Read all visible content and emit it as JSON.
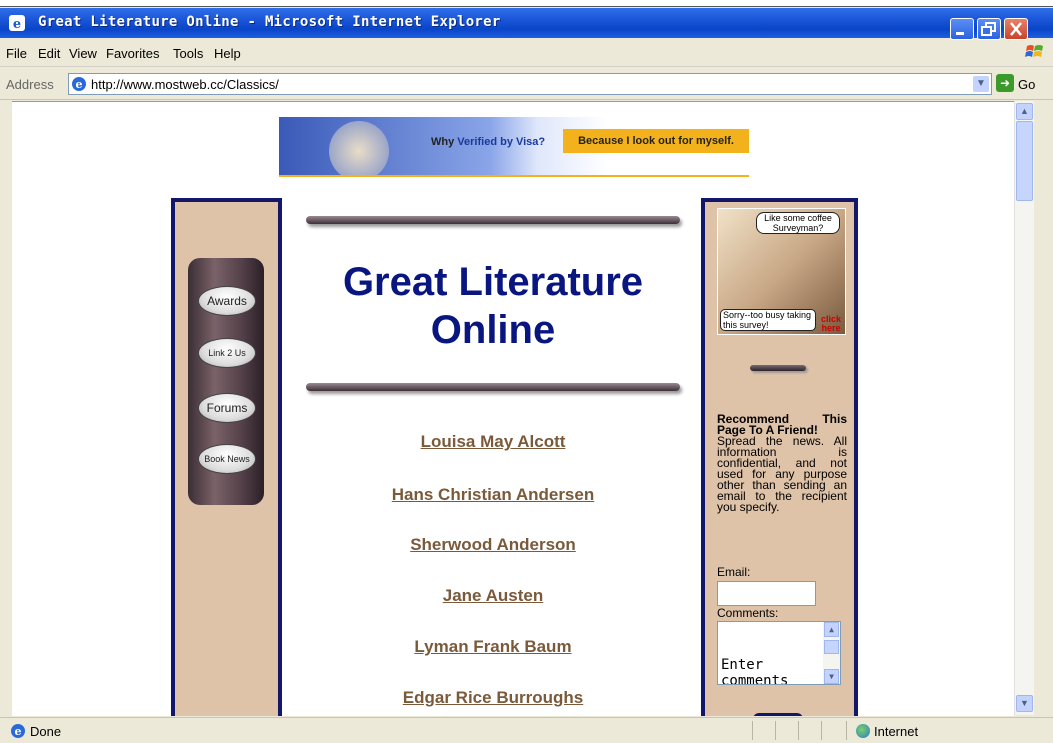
{
  "window": {
    "title": "Great Literature Online - Microsoft Internet Explorer"
  },
  "menu": [
    "File",
    "Edit",
    "View",
    "Favorites",
    "Tools",
    "Help"
  ],
  "address": {
    "label": "Address",
    "url": "http://www.mostweb.cc/Classics/",
    "go_label": "Go"
  },
  "ad": {
    "question_prefix": "Why",
    "question_brand": "Verified by Visa?",
    "tagline": "Because I look out for myself."
  },
  "sidebar_nav": [
    {
      "label": "Awards"
    },
    {
      "label": "Link 2 Us"
    },
    {
      "label": "Forums"
    },
    {
      "label": "Book News"
    }
  ],
  "main": {
    "title_line1": "Great Literature",
    "title_line2": "Online",
    "authors": [
      "Louisa May Alcott",
      "Hans Christian Andersen",
      "Sherwood Anderson",
      "Jane Austen",
      "Lyman Frank Baum",
      "Edgar Rice Burroughs"
    ]
  },
  "right_panel": {
    "survey_ad": {
      "bubble_top": "Like some coffee Surveyman?",
      "bubble_bottom": "Sorry--too busy taking this survey!",
      "click_here": "click here"
    },
    "recommend_heading": "Recommend This Page To A Friend!",
    "recommend_text": "Spread the news. All information is confidential, and not used for any purpose other than sending an email to the recipient you specify.",
    "email_label": "Email:",
    "comments_label": "Comments:",
    "comments_value": "Enter comments here."
  },
  "status": {
    "text": "Done",
    "zone": "Internet"
  },
  "colors": {
    "title_blue": "#0a1680",
    "panel_tan": "#dfc3a9",
    "panel_border": "#12176a",
    "link_brown": "#7a5a3a"
  }
}
